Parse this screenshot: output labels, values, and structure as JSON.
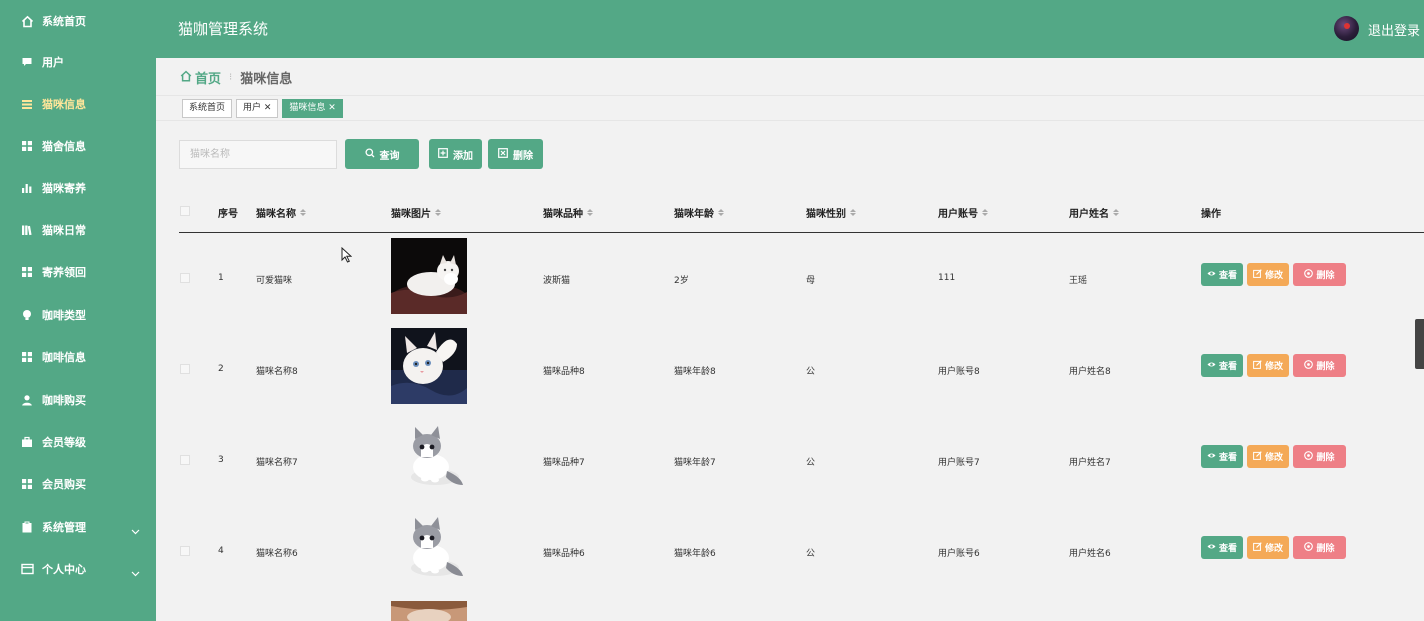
{
  "sidebar": {
    "items": [
      {
        "label": "系统首页",
        "icon": "home-icon"
      },
      {
        "label": "用户",
        "icon": "chat-icon"
      },
      {
        "label": "猫咪信息",
        "icon": "grid-icon",
        "active": true
      },
      {
        "label": "猫舍信息",
        "icon": "grid-icon"
      },
      {
        "label": "猫咪寄养",
        "icon": "bar-chart-icon"
      },
      {
        "label": "猫咪日常",
        "icon": "books-icon"
      },
      {
        "label": "寄养领回",
        "icon": "grid-icon"
      },
      {
        "label": "咖啡类型",
        "icon": "bulb-icon"
      },
      {
        "label": "咖啡信息",
        "icon": "grid-icon"
      },
      {
        "label": "咖啡购买",
        "icon": "user-icon"
      },
      {
        "label": "会员等级",
        "icon": "briefcase-icon"
      },
      {
        "label": "会员购买",
        "icon": "grid-icon"
      },
      {
        "label": "系统管理",
        "icon": "clipboard-icon",
        "expandable": true
      },
      {
        "label": "个人中心",
        "icon": "window-icon",
        "expandable": true
      }
    ]
  },
  "header": {
    "title": "猫咖管理系统",
    "logout_label": "退出登录"
  },
  "breadcrumb": {
    "home": "首页",
    "current": "猫咪信息"
  },
  "tags": [
    {
      "label": "系统首页",
      "closable": false,
      "active": false
    },
    {
      "label": "用户 ✕",
      "closable": true,
      "active": false
    },
    {
      "label": "猫咪信息 ✕",
      "closable": true,
      "active": true
    }
  ],
  "toolbar": {
    "search_placeholder": "猫咪名称",
    "query_label": "查询",
    "add_label": "添加",
    "delete_label": "删除"
  },
  "table": {
    "columns": [
      "序号",
      "猫咪名称",
      "猫咪图片",
      "猫咪品种",
      "猫咪年龄",
      "猫咪性别",
      "用户账号",
      "用户姓名",
      "操作"
    ],
    "rows": [
      {
        "index": "1",
        "name": "可爱猫咪",
        "breed": "波斯猫",
        "age": "2岁",
        "gender": "母",
        "account": "111",
        "username": "王瑶",
        "image": "white-cat-on-blanket"
      },
      {
        "index": "2",
        "name": "猫咪名称8",
        "breed": "猫咪品种8",
        "age": "猫咪年龄8",
        "gender": "公",
        "account": "用户账号8",
        "username": "用户姓名8",
        "image": "white-kitten-paw-up"
      },
      {
        "index": "3",
        "name": "猫咪名称7",
        "breed": "猫咪品种7",
        "age": "猫咪年龄7",
        "gender": "公",
        "account": "用户账号7",
        "username": "用户姓名7",
        "image": "grey-white-kitten"
      },
      {
        "index": "4",
        "name": "猫咪名称6",
        "breed": "猫咪品种6",
        "age": "猫咪年龄6",
        "gender": "公",
        "account": "用户账号6",
        "username": "用户姓名6",
        "image": "grey-white-kitten"
      }
    ],
    "actions": {
      "view": "查看",
      "edit": "修改",
      "delete": "删除"
    }
  },
  "colors": {
    "primary": "#53a886",
    "active_menu_text": "#ffe69a",
    "edit": "#f4a957",
    "delete": "#ee7f86"
  }
}
